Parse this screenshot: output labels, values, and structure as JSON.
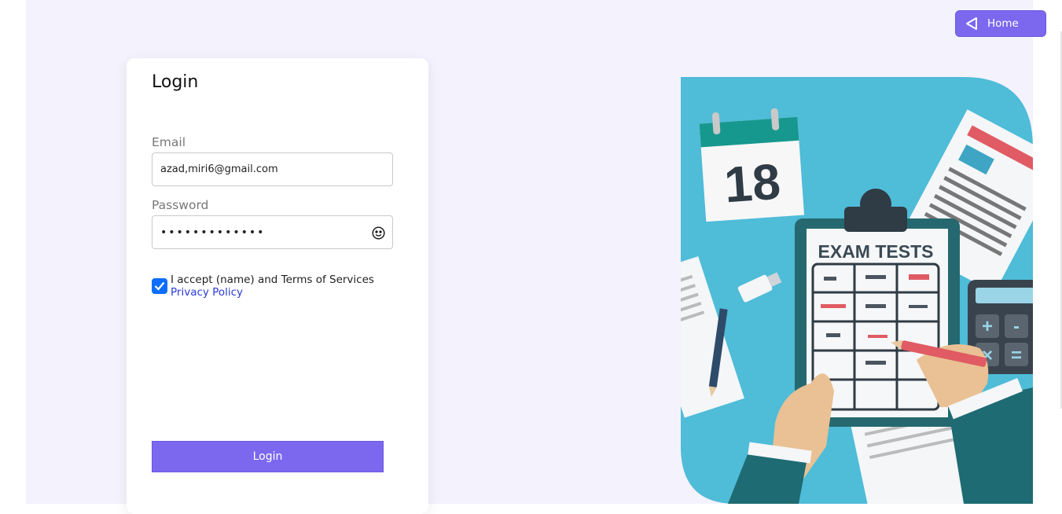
{
  "header": {
    "home_label": "Home"
  },
  "login": {
    "title": "Login",
    "email_label": "Email",
    "email_value": "azad,miri6@gmail.com",
    "password_label": "Password",
    "password_value": "•••••••••••••",
    "terms_text": "I accept (name) and Terms of Services",
    "privacy_link": "Privacy Policy",
    "checkbox_checked": true,
    "submit_label": "Login"
  },
  "illustration": {
    "calendar_day": "18",
    "clipboard_title": "EXAM TESTS"
  },
  "colors": {
    "accent": "#7b68ee",
    "background": "#f3f2fd",
    "illustration_bg": "#4fbcd8"
  }
}
